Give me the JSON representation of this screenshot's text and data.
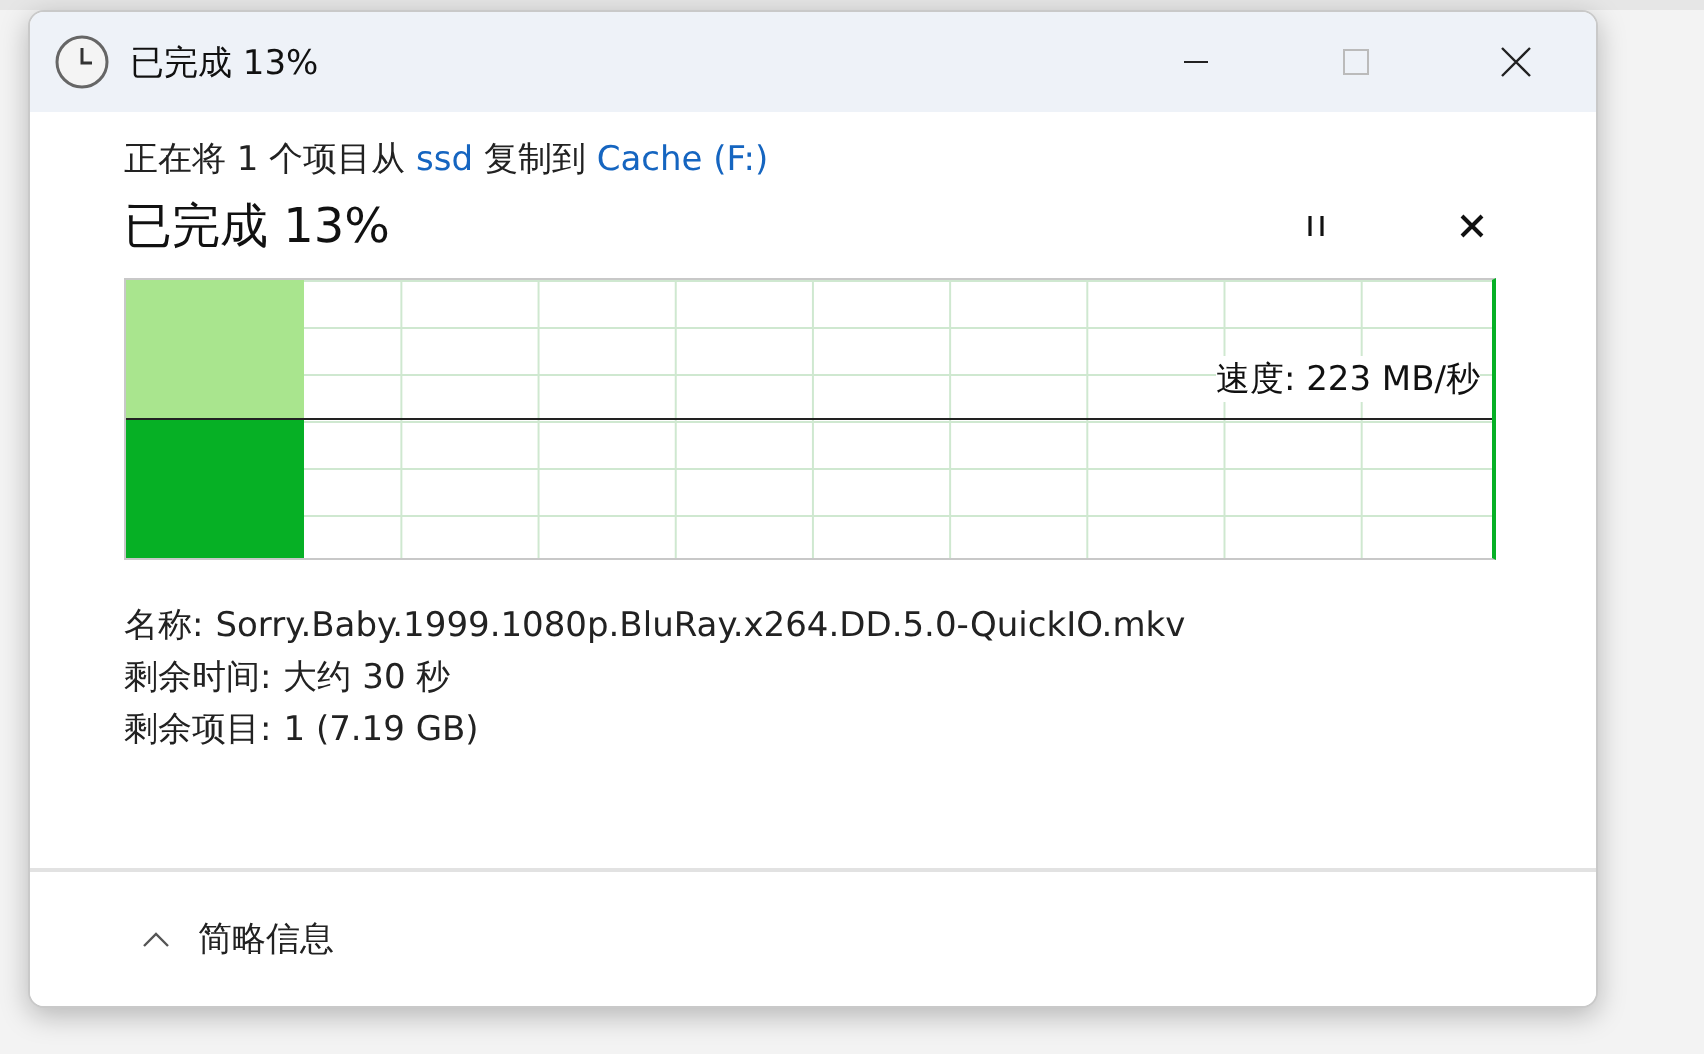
{
  "window": {
    "title": "已完成 13%"
  },
  "description": [
    {
      "kind": "text",
      "text": "正在将 1 个项目从 "
    },
    {
      "kind": "link",
      "text": "ssd"
    },
    {
      "kind": "text",
      "text": " 复制到 "
    },
    {
      "kind": "link",
      "text": "Cache (F:)"
    }
  ],
  "heading": "已完成 13%",
  "progress": {
    "level": 0.13,
    "speed": "速度: 223 MB/秒"
  },
  "details": [
    {
      "label": "名称:",
      "value": "Sorry.Baby.1999.1080p.BluRay.x264.DD.5.0-QuickIO.mkv"
    },
    {
      "label": "剩余时间:",
      "value": "大约 30 秒"
    },
    {
      "label": "剩余项目:",
      "value": "1 (7.19 GB)"
    }
  ],
  "footer": {
    "label": "简略信息",
    "expanded": true
  }
}
